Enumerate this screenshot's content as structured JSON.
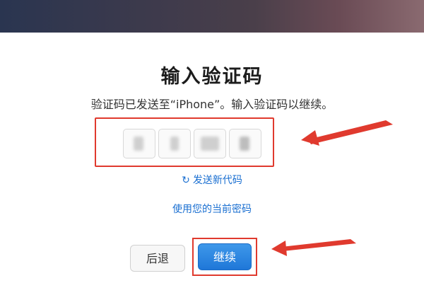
{
  "dialog": {
    "title": "输入验证码",
    "subtitle": "验证码已发送至“iPhone”。输入验证码以继续。",
    "resend_icon": "refresh-icon",
    "resend_label": "发送新代码",
    "use_password_label": "使用您的当前密码",
    "back_label": "后退",
    "continue_label": "继续"
  },
  "code_fields": {
    "count": 4
  },
  "colors": {
    "accent_blue": "#1a6fd1",
    "highlight_red": "#e03a2e"
  }
}
